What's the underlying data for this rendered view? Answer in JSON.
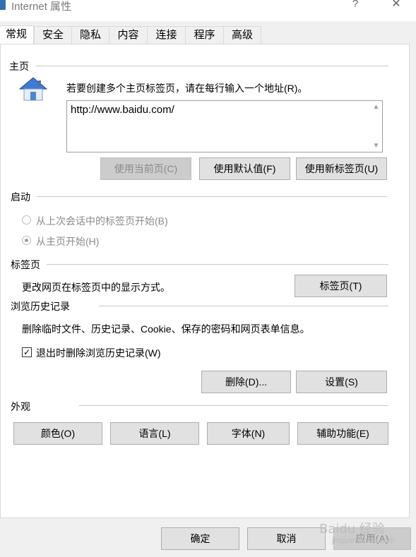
{
  "window": {
    "title": "Internet 属性",
    "help": "?",
    "close": "✕"
  },
  "tabs": [
    "常规",
    "安全",
    "隐私",
    "内容",
    "连接",
    "程序",
    "高级"
  ],
  "home": {
    "group_label": "主页",
    "instruction": "若要创建多个主页标签页，请在每行输入一个地址(R)。",
    "url_value": "http://www.baidu.com/",
    "buttons": {
      "current": "使用当前页(C)",
      "default": "使用默认值(F)",
      "new_tab": "使用新标签页(U)"
    }
  },
  "startup": {
    "group_label": "启动",
    "option_last_session": "从上次会话中的标签页开始(B)",
    "option_home": "从主页开始(H)",
    "selected": "home"
  },
  "tabs_section": {
    "group_label": "标签页",
    "description": "更改网页在标签页中的显示方式。",
    "button": "标签页(T)"
  },
  "history": {
    "group_label": "浏览历史记录",
    "description": "删除临时文件、历史记录、Cookie、保存的密码和网页表单信息。",
    "checkbox_label": "退出时删除浏览历史记录(W)",
    "checkbox_checked": true,
    "check_mark": "✓",
    "delete_button": "删除(D)...",
    "settings_button": "设置(S)"
  },
  "appearance": {
    "group_label": "外观",
    "buttons": [
      "颜色(O)",
      "语言(L)",
      "字体(N)",
      "辅助功能(E)"
    ]
  },
  "footer": {
    "ok": "确定",
    "cancel": "取消",
    "apply": "应用(A)"
  },
  "watermark": {
    "brand": "Baidu 经验",
    "url": "jingyan.baidu.com"
  }
}
